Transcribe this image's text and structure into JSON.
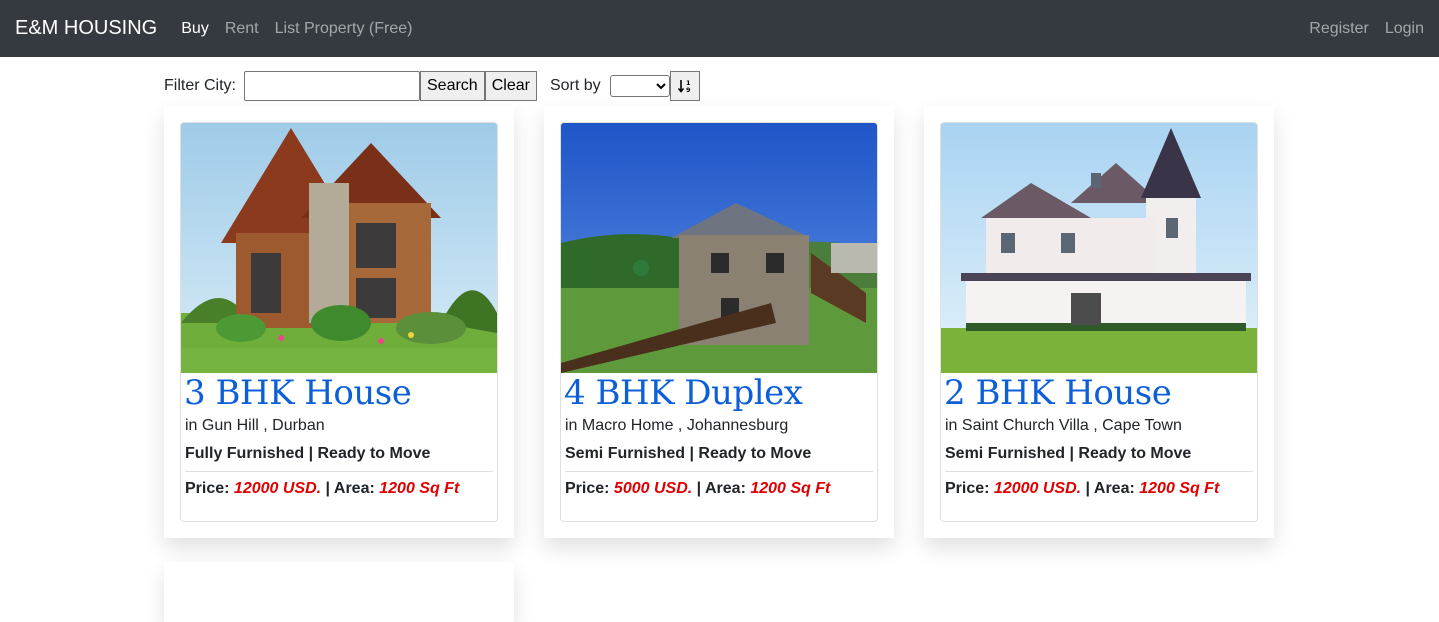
{
  "navbar": {
    "brand": "E&M HOUSING",
    "links": [
      {
        "label": "Buy",
        "active": true
      },
      {
        "label": "Rent"
      },
      {
        "label": "List Property (Free)"
      }
    ],
    "right_links": [
      {
        "label": "Register"
      },
      {
        "label": "Login"
      }
    ]
  },
  "filter": {
    "city_label": "Filter City:",
    "city_value": "",
    "search_label": "Search",
    "clear_label": "Clear",
    "sort_label": "Sort by",
    "sort_selected": "",
    "sort_icon": "sort-amount-down-icon"
  },
  "listings": [
    {
      "title": "3 BHK House",
      "location": "in Gun Hill , Durban",
      "furnishing": "Fully Furnished | Ready to Move",
      "price_label": "Price:",
      "price": "12000 USD.",
      "sep": "|",
      "area_label": "Area:",
      "area": "1200 Sq Ft",
      "image": "wooden-house-photo"
    },
    {
      "title": "4 BHK Duplex",
      "location": "in Macro Home , Johannesburg",
      "furnishing": "Semi Furnished | Ready to Move",
      "price_label": "Price:",
      "price": "5000 USD.",
      "sep": "|",
      "area_label": "Area:",
      "area": "1200 Sq Ft",
      "image": "stone-cottage-photo"
    },
    {
      "title": "2 BHK House",
      "location": "in Saint Church Villa , Cape Town",
      "furnishing": "Semi Furnished | Ready to Move",
      "price_label": "Price:",
      "price": "12000 USD.",
      "sep": "|",
      "area_label": "Area:",
      "area": "1200 Sq Ft",
      "image": "victorian-house-photo"
    }
  ],
  "colors": {
    "navbar": "#343a40",
    "title_blue": "#0d5fd8",
    "price_red": "#e00000"
  }
}
